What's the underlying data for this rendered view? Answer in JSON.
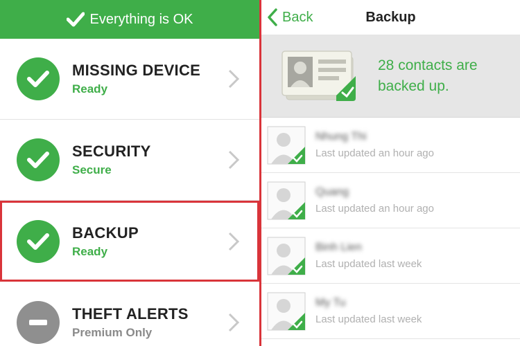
{
  "left": {
    "status_bar": {
      "text": "Everything is OK"
    },
    "items": [
      {
        "title": "MISSING DEVICE",
        "status": "Ready",
        "state": "ok"
      },
      {
        "title": "SECURITY",
        "status": "Secure",
        "state": "ok"
      },
      {
        "title": "BACKUP",
        "status": "Ready",
        "state": "ok"
      },
      {
        "title": "THEFT ALERTS",
        "status": "Premium Only",
        "state": "disabled"
      }
    ]
  },
  "right": {
    "nav": {
      "back_label": "Back",
      "title": "Backup"
    },
    "summary": {
      "text": "28 contacts are backed up."
    },
    "contacts": [
      {
        "name": "Nhung Thi",
        "updated": "Last updated an hour ago"
      },
      {
        "name": "Quang",
        "updated": "Last updated an hour ago"
      },
      {
        "name": "Binh Lien",
        "updated": "Last updated last week"
      },
      {
        "name": "My Tu",
        "updated": "Last updated last week"
      }
    ]
  },
  "colors": {
    "green": "#3fae49",
    "grey_badge": "#8f8f8f",
    "highlight_red": "#d9343a",
    "status_grey": "#8a8a8a"
  },
  "icons": {
    "check": "check-icon",
    "chevron": "chevron-right-icon",
    "minus": "minus-icon",
    "back": "chevron-left-icon",
    "contact_card": "contact-card-icon",
    "avatar": "person-avatar-icon"
  }
}
